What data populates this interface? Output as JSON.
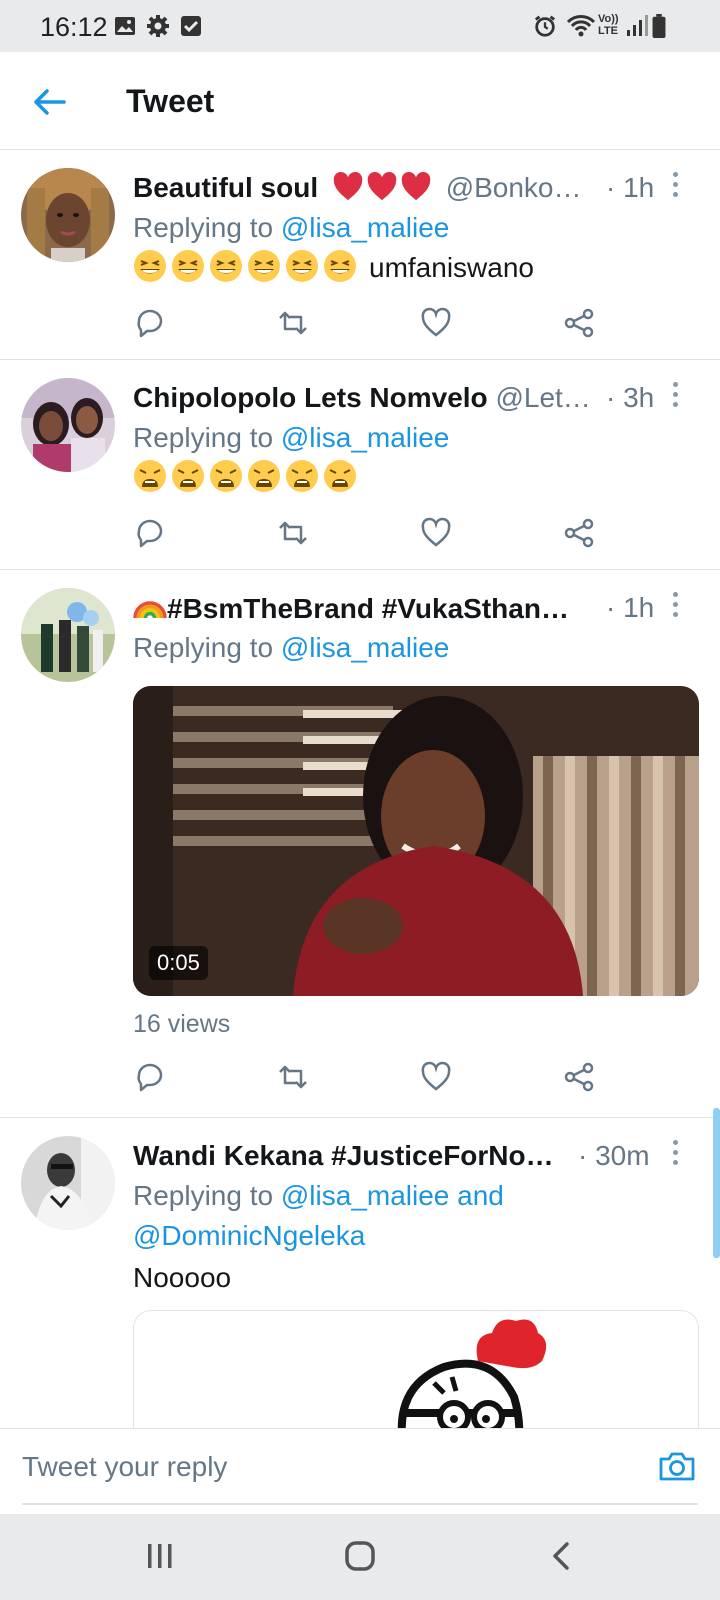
{
  "status_bar": {
    "time": "16:12",
    "icons": [
      "image-icon",
      "gear-icon",
      "checkbox-icon",
      "alarm-icon",
      "wifi-icon",
      "volte-icon",
      "signal-icon",
      "battery-icon"
    ],
    "volte_label": "Vo)) LTE"
  },
  "header": {
    "title": "Tweet",
    "back_icon": "arrow-left-icon",
    "accent_color": "#1b95e0"
  },
  "tweets": [
    {
      "name": "Beautiful soul",
      "name_emojis": [
        "red-heart",
        "red-heart",
        "red-heart"
      ],
      "handle": "@Bonko…",
      "time": "· 1h",
      "replying_prefix": "Replying to",
      "replying_to": "@lisa_maliee",
      "text_emojis": [
        "grinning-squinting",
        "grinning-squinting",
        "grinning-squinting",
        "grinning-squinting",
        "grinning-squinting",
        "grinning-squinting"
      ],
      "text": "umfaniswano"
    },
    {
      "name": "Chipolopolo Lets Nomvelo",
      "handle": "@Let…",
      "time": "· 3h",
      "replying_prefix": "Replying to",
      "replying_to": "@lisa_maliee",
      "text_emojis": [
        "weary-face",
        "weary-face",
        "weary-face",
        "weary-face",
        "weary-face",
        "weary-face"
      ]
    },
    {
      "name_emoji": "rainbow",
      "name": "#BsmTheBrand #VukaSthan…",
      "time": "· 1h",
      "replying_prefix": "Replying to",
      "replying_to": "@lisa_maliee",
      "video_duration": "0:05",
      "views": "16 views"
    },
    {
      "name": "Wandi Kekana #JusticeForNo…",
      "time": "· 30m",
      "replying_prefix": "Replying to",
      "replying_to": "@lisa_maliee and",
      "replying_to_2": "@DominicNgeleka",
      "text": "Nooooo"
    }
  ],
  "reply_bar": {
    "placeholder": "Tweet your reply",
    "camera_icon": "camera-icon"
  },
  "nav_bar": {
    "icons": [
      "recent-apps-icon",
      "home-icon",
      "back-icon"
    ]
  },
  "colors": {
    "link": "#1b95e0",
    "secondary_text": "#657786",
    "divider": "#e1e4e6"
  }
}
